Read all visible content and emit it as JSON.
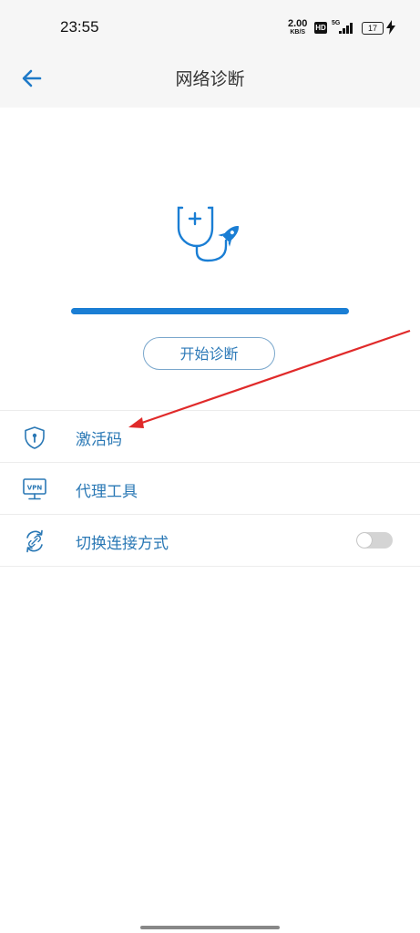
{
  "status_bar": {
    "time": "23:55",
    "speed_value": "2.00",
    "speed_unit": "KB/S",
    "hd_badge": "HD",
    "network_type": "5G",
    "battery_level": "17"
  },
  "header": {
    "title": "网络诊断"
  },
  "diagnosis": {
    "progress_percent": 100,
    "start_button_label": "开始诊断"
  },
  "menu": {
    "items": [
      {
        "label": "激活码",
        "icon": "shield-key-icon"
      },
      {
        "label": "代理工具",
        "icon": "vpn-monitor-icon"
      },
      {
        "label": "切换连接方式",
        "icon": "switch-connection-icon",
        "toggle_on": false
      }
    ]
  },
  "colors": {
    "accent": "#1a7ed4",
    "label_blue": "#2a78b5",
    "annotation_arrow": "#e02a2a"
  }
}
